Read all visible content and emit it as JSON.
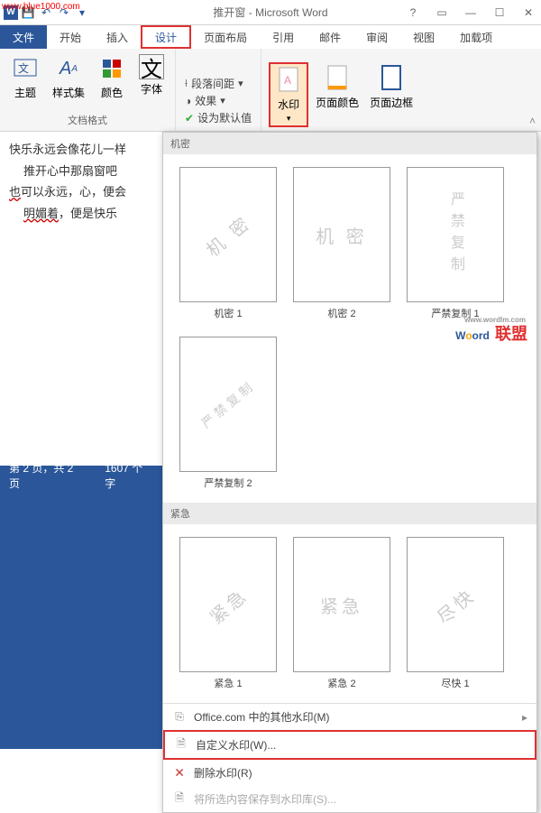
{
  "urlTag": "www.blue1000.com",
  "title": "推开窗 - Microsoft Word",
  "tabs": {
    "file": "文件",
    "home": "开始",
    "insert": "插入",
    "design": "设计",
    "layout": "页面布局",
    "ref": "引用",
    "mail": "邮件",
    "review": "审阅",
    "view": "视图",
    "addin": "加载项"
  },
  "ribbon": {
    "themes": "主题",
    "styleSet": "样式集",
    "colors": "颜色",
    "fonts": "字体",
    "paraSpace": "段落间距",
    "effects": "效果",
    "setDefault": "设为默认值",
    "docFormat": "文档格式",
    "watermark": "水印",
    "pageColor": "页面颜色",
    "pageBorder": "页面边框"
  },
  "doc": {
    "l1": "快乐永远会像花儿一样",
    "l2": "推开心中那扇窗吧",
    "l3a": "也",
    "l3b": "可以永远，心，便会",
    "l4a": "明媚着",
    "l4b": "，便是快乐"
  },
  "status": {
    "page": "第 2 页，共 2 页",
    "words": "1607 个字"
  },
  "gallery": {
    "sec1": "机密",
    "sec2": "紧急",
    "items": {
      "jm1": {
        "wm": "机 密",
        "label": "机密 1"
      },
      "jm2": {
        "wm": "机 密",
        "label": "机密 2"
      },
      "yj1": {
        "wm": "严禁复制",
        "label": "严禁复制 1"
      },
      "yj2": {
        "wm": "严禁复制",
        "label": "严禁复制 2"
      },
      "jj1": {
        "wm": "紧急",
        "label": "紧急 1"
      },
      "jj2": {
        "wm": "紧急",
        "label": "紧急 2"
      },
      "jk1": {
        "wm": "尽快",
        "label": "尽快 1"
      }
    },
    "footer": {
      "office": "Office.com 中的其他水印(M)",
      "custom": "自定义水印(W)...",
      "remove": "删除水印(R)",
      "save": "将所选内容保存到水印库(S)..."
    },
    "logo": {
      "w": "W",
      "ord": "ord",
      "lm": "联盟",
      "sm": "www.wordlm.com"
    }
  }
}
